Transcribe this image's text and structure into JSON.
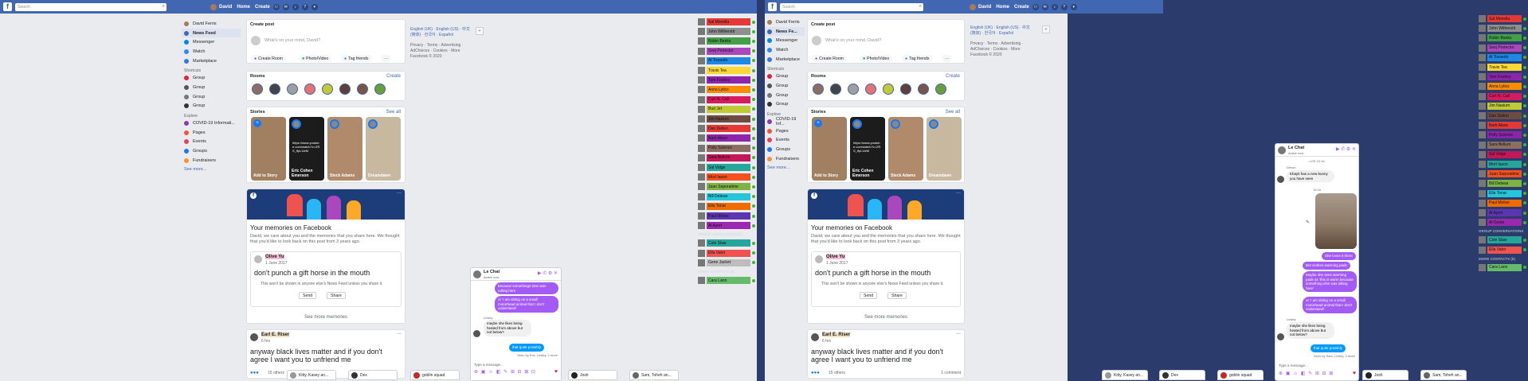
{
  "left": {
    "search_placeholder": "Search",
    "user_name": "David",
    "home_label": "Home",
    "create_label": "Create",
    "nav": {
      "user": "David Ferris",
      "news_feed": "News Feed",
      "messenger": "Messenger",
      "watch": "Watch",
      "marketplace": "Marketplace",
      "shortcuts": "Shortcuts",
      "group1": "Group",
      "group2": "Group",
      "group3": "Group",
      "group4": "Group",
      "explore": "Explore",
      "covid": "COVID-19 Informati...",
      "pages": "Pages",
      "events": "Events",
      "groups": "Groups",
      "fundraisers": "Fundraisers",
      "see_more": "See more..."
    },
    "create_post": {
      "title": "Create post",
      "placeholder": "What's on your mind, David?",
      "room": "Create Room",
      "photo": "Photo/Video",
      "tag": "Tag friends"
    },
    "rooms": {
      "title": "Rooms",
      "create": "Create"
    },
    "stories": {
      "title": "Stories",
      "see_all": "See all",
      "s1": "Add to Story",
      "s2": "Eric Cohen Emerson",
      "s3": "Steck Adams",
      "s4": "Dreamdawn",
      "link": "https://www.youtube.com/watch?v=ZRS_tfpLUeM"
    },
    "memories": {
      "title": "Your memories on Facebook",
      "text": "David, we care about you and the memories that you share here. We thought that you'd like to look back on this post from 3 years ago.",
      "author": "Olive Yu",
      "date": "1 June 2017",
      "post": "don't punch a gift horse in the mouth",
      "note": "This won't be shown in anyone else's News Feed unless you share it.",
      "send": "Send",
      "share": "Share",
      "see_more": "See more memories"
    },
    "post2": {
      "author": "Earl E. Riser",
      "time": "6 hrs",
      "text": "anyway black lives matter and if you don't agree I want you to unfriend me",
      "reactions": "15 others"
    },
    "footer": {
      "langs": "English (UK) · English (US) · 中文(简体) · 한국어 · Español",
      "links": "Privacy · Terms · Advertising · AdChoices · Cookies · More",
      "copy": "Facebook © 2020"
    },
    "chat": {
      "name": "Le Chat",
      "status": "Active now",
      "b1": "because somethings time was rolling here",
      "b2": "or 'I am sitting on a small motorhead animal that I don't understand'",
      "sender": "Lesley",
      "b3": "maybe she likes being heated from above but not below?",
      "b4": "that quite possibly",
      "seen": "Seen by Eric, Lesley, 2 more",
      "input": "Type a message..."
    },
    "tabs": [
      "Kitty, Kasey an...",
      "Dex",
      "goblin squad",
      "Josh",
      "Sam, Toheh an..."
    ],
    "contacts": [
      "Sal Monella",
      "John Witherstit",
      "Robin Banks",
      "Seej Protector",
      "Al Tossedo",
      "Travis Tea",
      "Tom Foolery",
      "Anna Lytics",
      "Curt N. Call",
      "Bud Jet",
      "Jim Nasium",
      "Dan Delion",
      "Barb Akew",
      "Polly Science",
      "Sara Bellum",
      "Sal Vidge",
      "Mort Iason",
      "Juan Soporatime",
      "Bill Debear",
      "Ella Tonar",
      "Paul Molive",
      "Al Ayert"
    ],
    "group_conv": "GROUP CONVERSATIONS",
    "groups": [
      "Cole Slaw",
      "Ella Vator",
      "Gene Jacket"
    ],
    "more_contacts": "MORE CONTACTS (5)",
    "last_contact": "Cara Lann"
  },
  "right": {
    "nav_news": "News Fe...",
    "covid": "COVID-19 Inf...",
    "chat": {
      "name": "Le Chat",
      "status": "Active now",
      "time1": "LOS 10:16",
      "sender1": "Devon",
      "b1": "Khayti has a new bunny you have seen",
      "time2": "10:16",
      "b2": "She loves it there",
      "b3": "But clothes-warming pads",
      "b4": "Maybe she sees warming pads as 'this is warm because something else was sitting here'",
      "b5": "or 'I am sitting on a small motorhead animal that I don't understand'",
      "sender2": "Lesley",
      "b6": "maybe she likes being heated from above but not below?",
      "b7": "that quite possibly",
      "seen": "Seen by Sam, Lesley, 3 more",
      "input": "Type a message..."
    },
    "comments": "1 comment",
    "contacts2": [
      "Sal Monella",
      "John Witherstit",
      "Robin Banks",
      "Seej Protector",
      "Al Tossedo",
      "Travis Tea",
      "Tom Foolery",
      "Anna Lytics",
      "Curt N. Call",
      "Jim Nasium",
      "Dan Delion",
      "Barb Akew",
      "Polly Science",
      "Sara Bellum",
      "Sal Vidge",
      "Mort Iason",
      "Juan Soporatime",
      "Bill Debear",
      "Ella Tonar",
      "Paul Molive",
      "Al Ayert",
      "Al Gente"
    ],
    "group_conv": "GROUP CONVERSATIONS",
    "groups2": [
      "Cole Slaw",
      "Ella Vator"
    ],
    "more_contacts": "MORE CONTACTS (5)",
    "last_contact": "Cara Lann"
  },
  "colors": {
    "fb_blue": "#4267b2",
    "bg": "#e9ebee",
    "outer": "#2b3b6b"
  }
}
